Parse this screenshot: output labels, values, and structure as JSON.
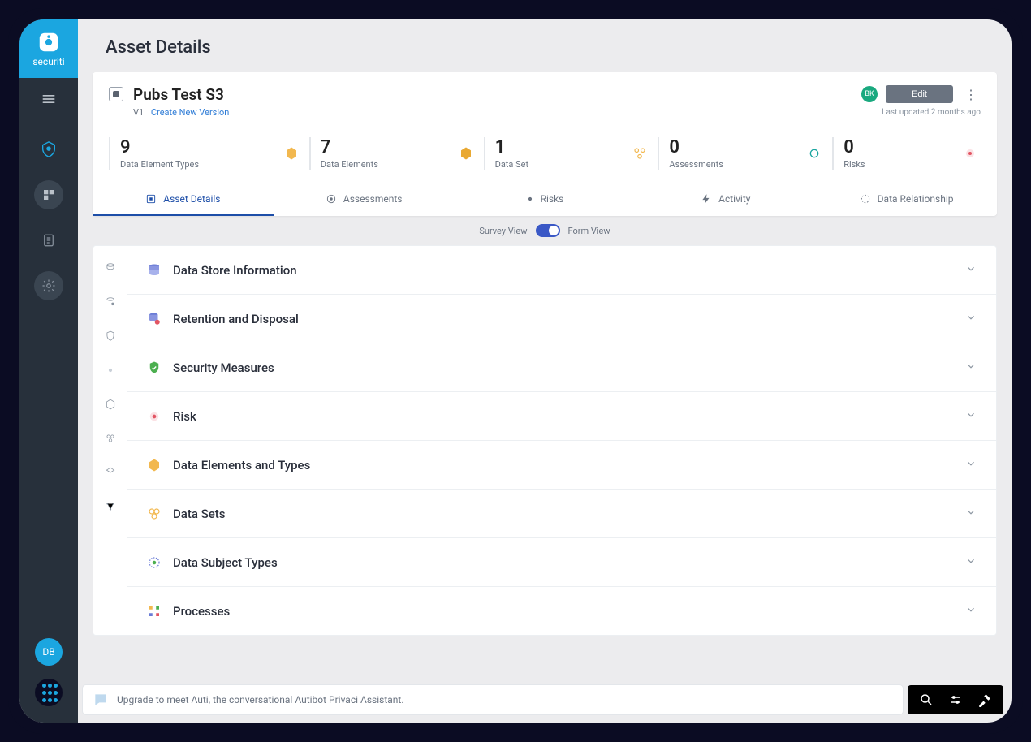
{
  "brand": {
    "name": "securiti"
  },
  "page": {
    "title": "Asset Details"
  },
  "asset": {
    "name": "Pubs Test S3",
    "version": "V1",
    "create_new_version": "Create New Version",
    "bk": "BK",
    "edit": "Edit",
    "last_updated": "Last updated 2 months ago"
  },
  "stats": [
    {
      "value": "9",
      "label": "Data Element Types"
    },
    {
      "value": "7",
      "label": "Data Elements"
    },
    {
      "value": "1",
      "label": "Data Set"
    },
    {
      "value": "0",
      "label": "Assessments"
    },
    {
      "value": "0",
      "label": "Risks"
    }
  ],
  "tabs": [
    {
      "label": "Asset Details"
    },
    {
      "label": "Assessments"
    },
    {
      "label": "Risks"
    },
    {
      "label": "Activity"
    },
    {
      "label": "Data Relationship"
    }
  ],
  "view_toggle": {
    "left": "Survey View",
    "right": "Form View"
  },
  "sections": [
    {
      "title": "Data Store Information"
    },
    {
      "title": "Retention and Disposal"
    },
    {
      "title": "Security Measures"
    },
    {
      "title": "Risk"
    },
    {
      "title": "Data Elements and Types"
    },
    {
      "title": "Data Sets"
    },
    {
      "title": "Data Subject Types"
    },
    {
      "title": "Processes"
    }
  ],
  "sidebar": {
    "db": "DB"
  },
  "footer": {
    "message": "Upgrade to meet Auti, the conversational Autibot Privaci Assistant."
  }
}
